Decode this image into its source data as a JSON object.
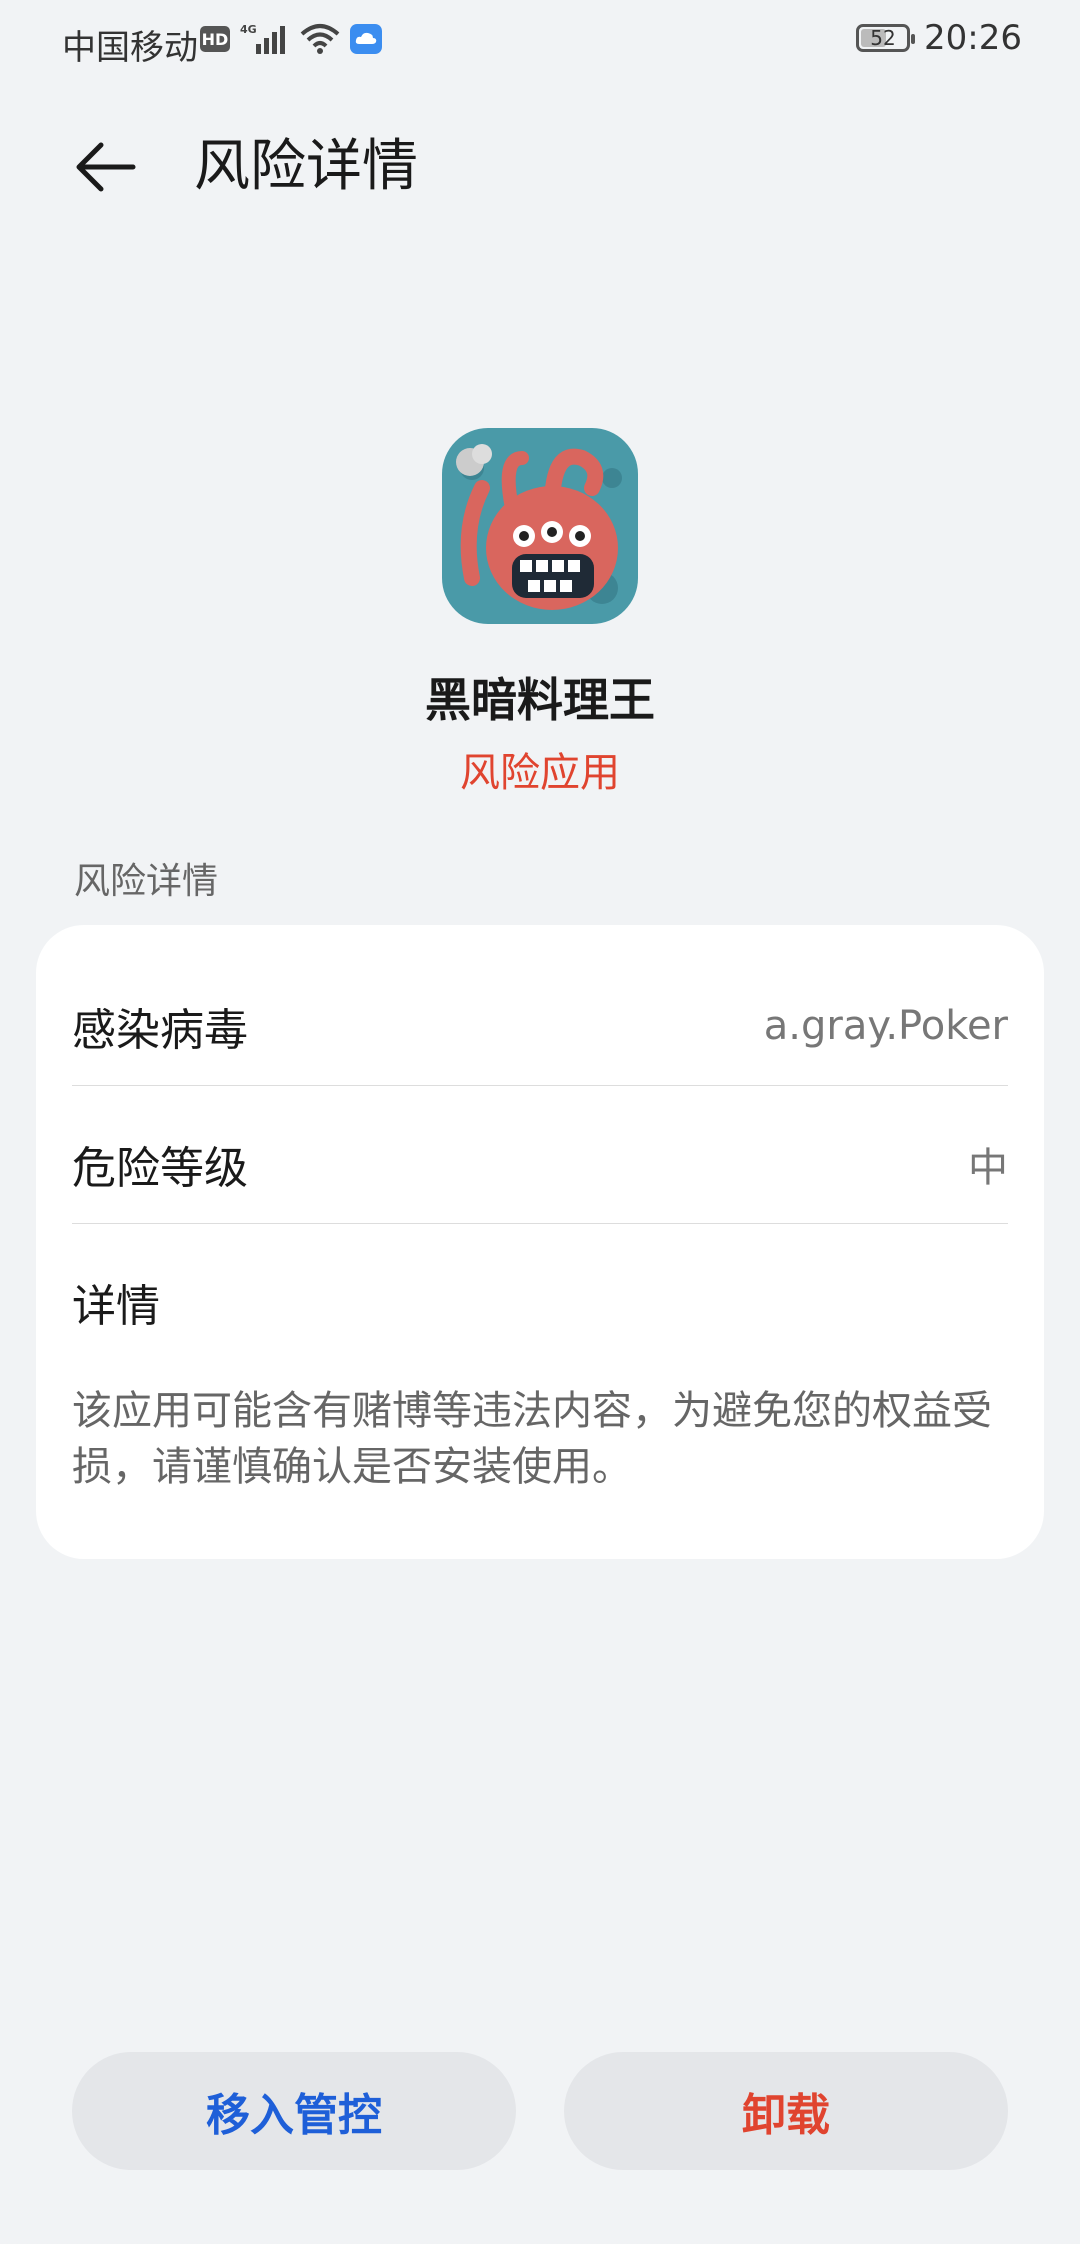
{
  "status_bar": {
    "carrier": "中国移动",
    "hd": "HD",
    "network": "4G",
    "battery": "52",
    "battery_level": 0.52,
    "time": "20:26"
  },
  "header": {
    "title": "风险详情"
  },
  "app": {
    "name": "黑暗料理王",
    "risk_label": "风险应用"
  },
  "section": {
    "label": "风险详情"
  },
  "details": {
    "virus_label": "感染病毒",
    "virus_value": "a.gray.Poker",
    "level_label": "危险等级",
    "level_value": "中",
    "detail_label": "详情",
    "detail_text": "该应用可能含有赌博等违法内容，为避免您的权益受损，请谨慎确认是否安装使用。"
  },
  "actions": {
    "control_label": "移入管控",
    "uninstall_label": "卸载"
  },
  "colors": {
    "background": "#f1f3f5",
    "risk_red": "#e0442f",
    "action_blue": "#1e5fd8"
  }
}
